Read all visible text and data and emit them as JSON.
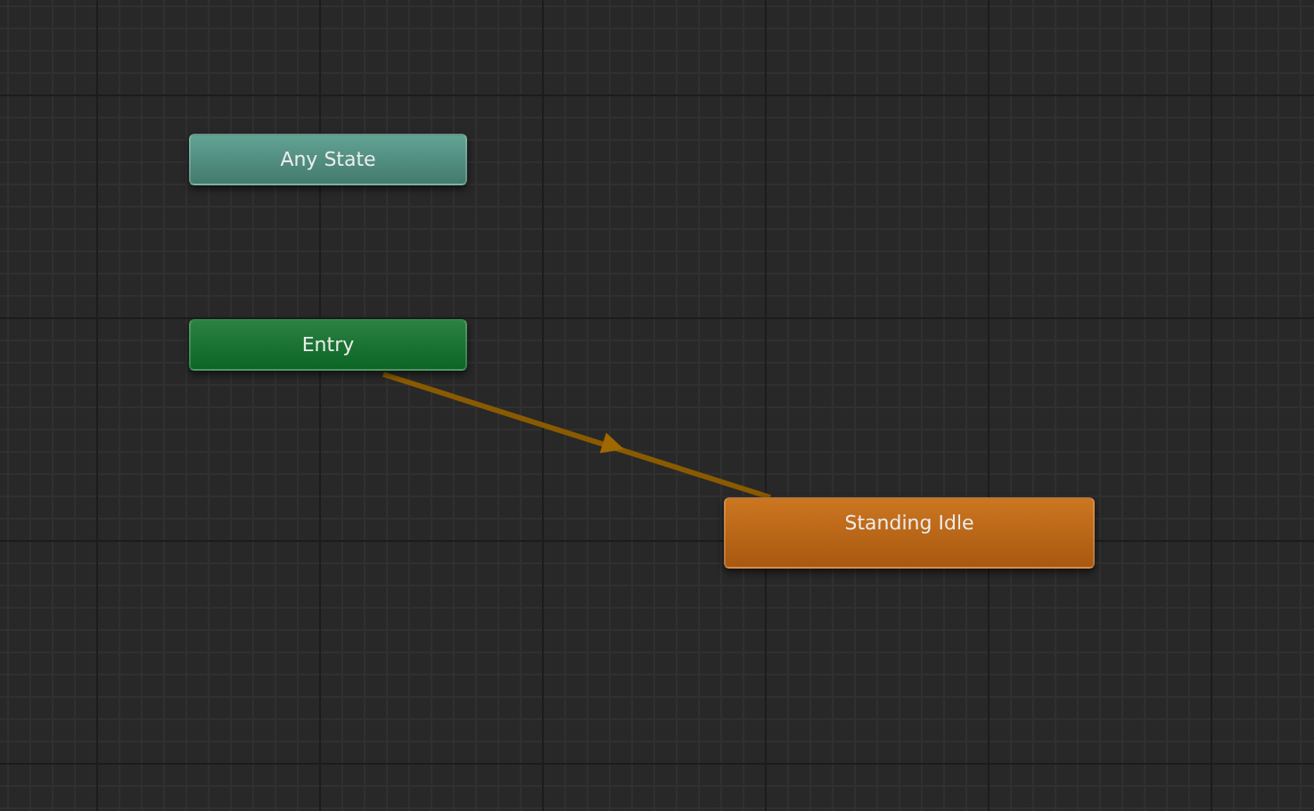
{
  "nodes": [
    {
      "label": "Any State",
      "kind": "any_state",
      "default": false
    },
    {
      "label": "Entry",
      "kind": "entry",
      "default": false
    },
    {
      "label": "Standing Idle",
      "kind": "state",
      "default": true
    }
  ]
}
